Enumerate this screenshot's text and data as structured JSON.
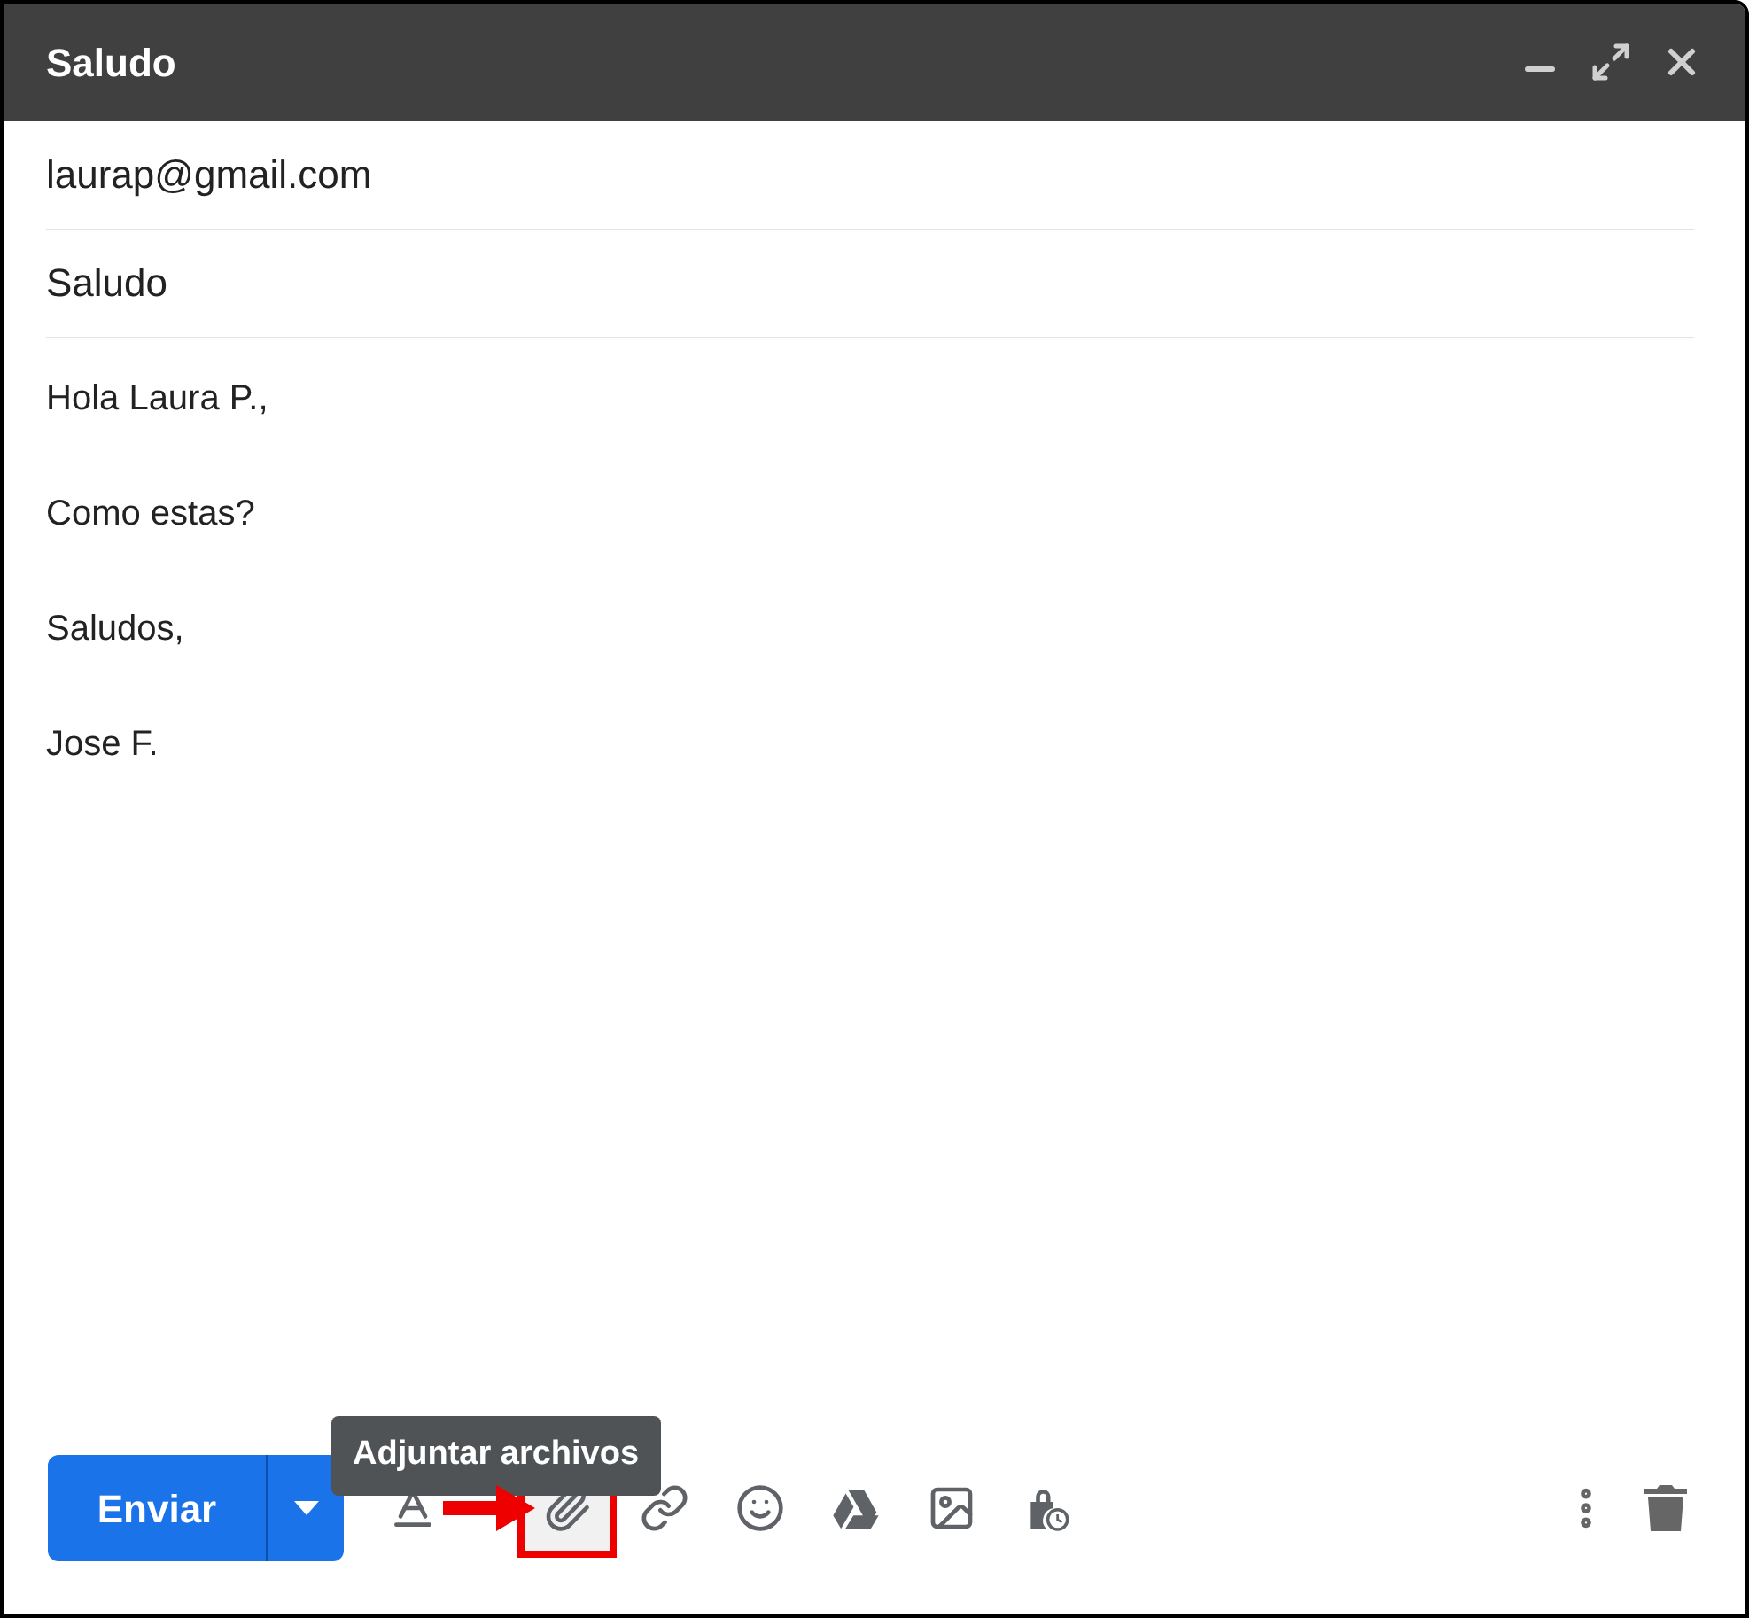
{
  "window": {
    "title": "Saludo"
  },
  "to": {
    "value": "laurap@gmail.com"
  },
  "subject": {
    "value": "Saludo"
  },
  "body": [
    "Hola Laura P.,",
    "Como estas?",
    "Saludos,",
    "Jose F."
  ],
  "send_button": {
    "label": "Enviar"
  },
  "tooltip": {
    "text": "Adjuntar archivos"
  },
  "toolbar": [
    {
      "kind": "format",
      "highlighted": false
    },
    {
      "kind": "attach",
      "highlighted": true
    },
    {
      "kind": "link",
      "highlighted": false
    },
    {
      "kind": "emoji",
      "highlighted": false
    },
    {
      "kind": "drive",
      "highlighted": false
    },
    {
      "kind": "photo",
      "highlighted": false
    },
    {
      "kind": "confidential",
      "highlighted": false
    }
  ]
}
